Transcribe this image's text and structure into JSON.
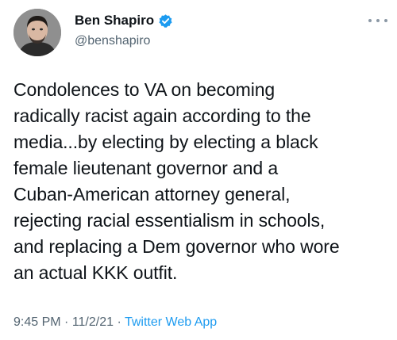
{
  "author": {
    "display_name": "Ben Shapiro",
    "handle": "@benshapiro",
    "verified": true,
    "avatar_icon": "profile-photo",
    "verified_icon": "verified-badge-icon"
  },
  "tweet": {
    "text": "Condolences to VA on becoming\nradically racist again according to the\nmedia...by electing by electing a black\nfemale lieutenant governor and a\nCuban-American attorney general,\nrejecting racial essentialism in schools,\nand replacing a Dem governor who wore\nan actual KKK outfit.",
    "time": "9:45 PM",
    "separator": " · ",
    "date": "11/2/21",
    "source": "Twitter Web App"
  },
  "colors": {
    "text_primary": "#0f1419",
    "text_secondary": "#536471",
    "accent": "#1d9bf0"
  }
}
